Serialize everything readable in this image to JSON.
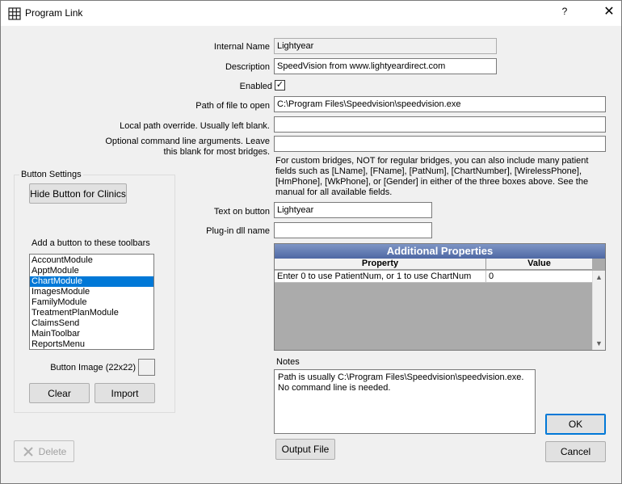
{
  "window": {
    "title": "Program Link",
    "help_label": "?",
    "close_label": "✕"
  },
  "form": {
    "internal_name_label": "Internal Name",
    "internal_name_value": "Lightyear",
    "description_label": "Description",
    "description_value": "SpeedVision from www.lightyeardirect.com",
    "enabled_label": "Enabled",
    "enabled_checked": "✓",
    "path_label": "Path of file to open",
    "path_value": "C:\\Program Files\\Speedvision\\speedvision.exe",
    "local_override_label": "Local path override.  Usually left blank.",
    "local_override_value": "",
    "cmd_args_label": "Optional command line arguments.  Leave this blank for most bridges.",
    "cmd_args_value": "",
    "custom_bridge_help": "For custom bridges, NOT for regular bridges, you can also include many patient fields such as [LName], [FName], [PatNum], [ChartNumber], [WirelessPhone], [HmPhone], [WkPhone], or [Gender] in either of the three boxes above. See the manual for all available fields.",
    "text_on_button_label": "Text on button",
    "text_on_button_value": "Lightyear",
    "plugin_dll_label": "Plug-in dll name",
    "plugin_dll_value": ""
  },
  "button_settings": {
    "group_title": "Button Settings",
    "hide_button_label": "Hide Button for Clinics",
    "toolbars_label": "Add a button to these toolbars",
    "toolbars": [
      {
        "label": "AccountModule"
      },
      {
        "label": "ApptModule"
      },
      {
        "label": "ChartModule"
      },
      {
        "label": "ImagesModule"
      },
      {
        "label": "FamilyModule"
      },
      {
        "label": "TreatmentPlanModule"
      },
      {
        "label": "ClaimsSend"
      },
      {
        "label": "MainToolbar"
      },
      {
        "label": "ReportsMenu"
      }
    ],
    "selected_toolbar": "ChartModule",
    "button_image_label": "Button Image (22x22)",
    "clear_label": "Clear",
    "import_label": "Import"
  },
  "additional_properties": {
    "title": "Additional Properties",
    "columns": [
      "Property",
      "Value"
    ],
    "rows": [
      {
        "property": "Enter 0 to use PatientNum, or 1 to use ChartNum",
        "value": "0"
      }
    ]
  },
  "notes": {
    "label": "Notes",
    "value": "Path is usually C:\\Program Files\\Speedvision\\speedvision.exe.  No command line is needed."
  },
  "footer": {
    "delete_label": "Delete",
    "output_file_label": "Output File",
    "ok_label": "OK",
    "cancel_label": "Cancel"
  },
  "colors": {
    "selection": "#0078d7",
    "grid_title_bg": "#5a73ae",
    "grid_body_bg": "#ababab"
  }
}
